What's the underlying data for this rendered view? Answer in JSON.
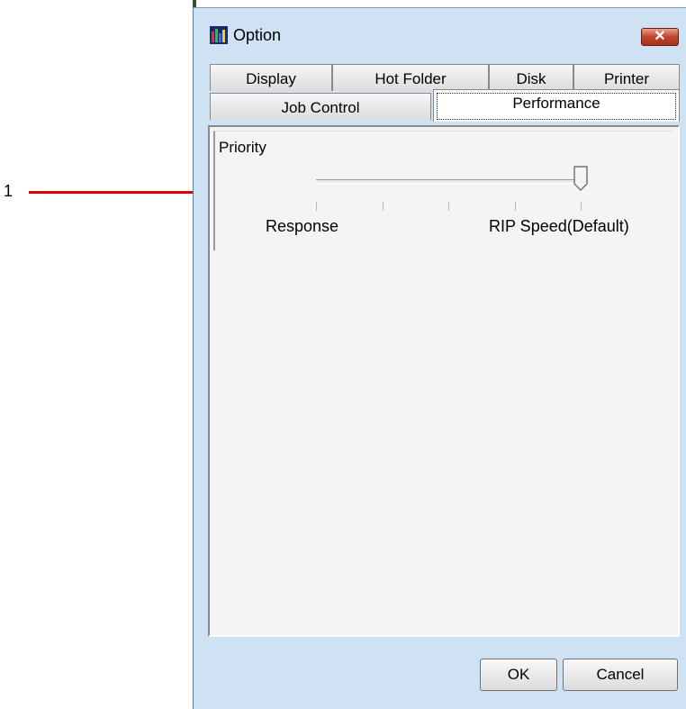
{
  "callout": {
    "number": "1"
  },
  "window": {
    "title": "Option",
    "close_symbol": "✕"
  },
  "tabs": {
    "row1": [
      "Display",
      "Hot Folder",
      "Disk",
      "Printer"
    ],
    "row2": [
      "Job Control",
      "Performance"
    ],
    "active": "Performance"
  },
  "priority": {
    "label": "Priority",
    "min_label": "Response",
    "max_label": "RIP Speed(Default)",
    "tick_count": 5,
    "selected_step": 4
  },
  "buttons": {
    "ok": "OK",
    "cancel": "Cancel"
  },
  "colors": {
    "callout_line": "#e00000",
    "window_frame": "#cfe2f3",
    "close_button": "#c0452a"
  }
}
